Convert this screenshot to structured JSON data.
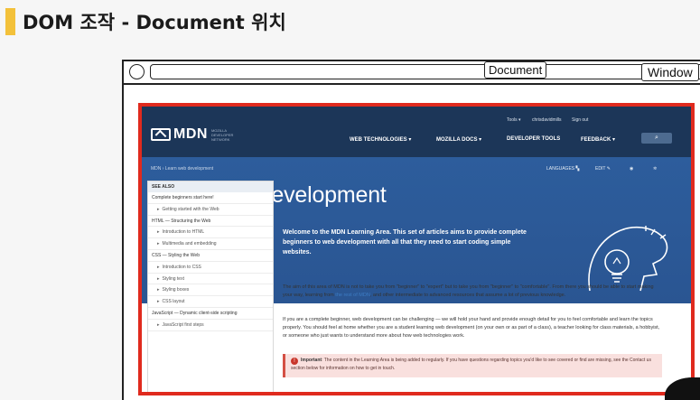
{
  "slide": {
    "title": "DOM 조작 - Document 위치"
  },
  "window": {
    "label": "Window"
  },
  "document_label": "Document",
  "mdn": {
    "logo": "MDN",
    "logo_sub": "MOZILLA DEVELOPER NETWORK",
    "util_tools": "Tools ▾",
    "util_user": "chrisdavidmills",
    "util_signout": "Sign out",
    "nav": [
      "WEB TECHNOLOGIES ▾",
      "MOZILLA DOCS ▾",
      "DEVELOPER TOOLS",
      "FEEDBACK ▾"
    ],
    "search_icon": "⌕",
    "breadcrumb": "MDN ›  Learn web development",
    "languages": "LANGUAGES",
    "edit": "EDIT",
    "title": "Learn web development",
    "intro": "Welcome to the MDN Learning Area. This set of articles aims to provide complete beginners to web development with all that they need to start coding simple websites.",
    "sidebar": {
      "heading": "SEE ALSO",
      "rows": [
        {
          "label": "Complete beginners start here!",
          "sub": false
        },
        {
          "label": "Getting started with the Web",
          "sub": true
        },
        {
          "label": "HTML — Structuring the Web",
          "sub": false
        },
        {
          "label": "Introduction to HTML",
          "sub": true
        },
        {
          "label": "Multimedia and embedding",
          "sub": true
        },
        {
          "label": "CSS — Styling the Web",
          "sub": false
        },
        {
          "label": "Introduction to CSS",
          "sub": true
        },
        {
          "label": "Styling text",
          "sub": true
        },
        {
          "label": "Styling boxes",
          "sub": true
        },
        {
          "label": "CSS layout",
          "sub": true
        },
        {
          "label": "JavaScript — Dynamic client-side scripting",
          "sub": false
        },
        {
          "label": "JavaScript first steps",
          "sub": true
        }
      ]
    },
    "para1_a": "The aim of this area of MDN is not to take you from \"beginner\" to \"expert\" but to take you from \"beginner\" to \"comfortable\". From there you should be able to start making your way, learning from ",
    "para1_link": "the rest of MDN",
    "para1_b": ", and other intermediate to advanced resources that assume a lot of previous knowledge.",
    "para2": "If you are a complete beginner, web development can be challenging — we will hold your hand and provide enough detail for you to feel comfortable and learn the topics properly. You should feel at home whether you are a student learning web development (on your own or as part of a class), a teacher looking for class materials, a hobbyist, or someone who just wants to understand more about how web technologies work.",
    "note_label": "Important",
    "note_text": ": The content in the Learning Area is being added to regularly. If you have questions regarding topics you'd like to see covered or find are missing, see the Contact us section below for information on how to get in touch."
  }
}
